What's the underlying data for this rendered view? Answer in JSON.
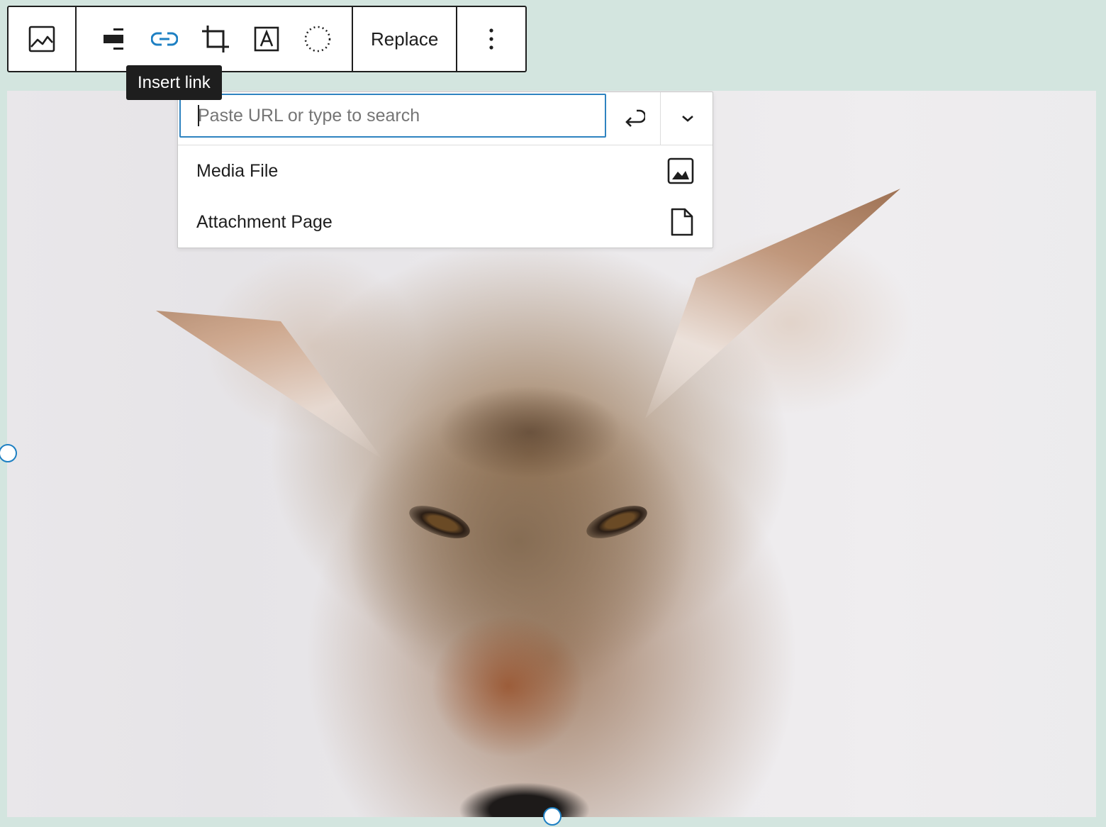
{
  "toolbar": {
    "buttons": [
      {
        "name": "image-block",
        "icon": "image-icon",
        "label": "Image"
      },
      {
        "name": "align",
        "icon": "align-icon",
        "label": "Align"
      },
      {
        "name": "insert-link",
        "icon": "link-icon",
        "label": "Insert link",
        "active": true
      },
      {
        "name": "crop",
        "icon": "crop-icon",
        "label": "Crop"
      },
      {
        "name": "text-overlay",
        "icon": "text-overlay-icon",
        "label": "Add text over image"
      },
      {
        "name": "select-motion",
        "icon": "circle-dotted-icon",
        "label": "Selection"
      }
    ],
    "replace_label": "Replace",
    "more_icon": "more-vertical-icon"
  },
  "tooltip": {
    "text": "Insert link"
  },
  "link_popover": {
    "search": {
      "placeholder": "Paste URL or type to search",
      "value": ""
    },
    "submit_icon": "enter-icon",
    "settings_icon": "chevron-down-icon",
    "suggestions": [
      {
        "label": "Media File",
        "icon": "media-image-icon"
      },
      {
        "label": "Attachment Page",
        "icon": "page-icon"
      }
    ]
  },
  "image": {
    "subject": "coyote photo"
  },
  "colors": {
    "accent": "#2f83c0",
    "link_active": "#1e80c3",
    "canvas_bg": "#d3e5df",
    "text": "#1e1e1e"
  }
}
